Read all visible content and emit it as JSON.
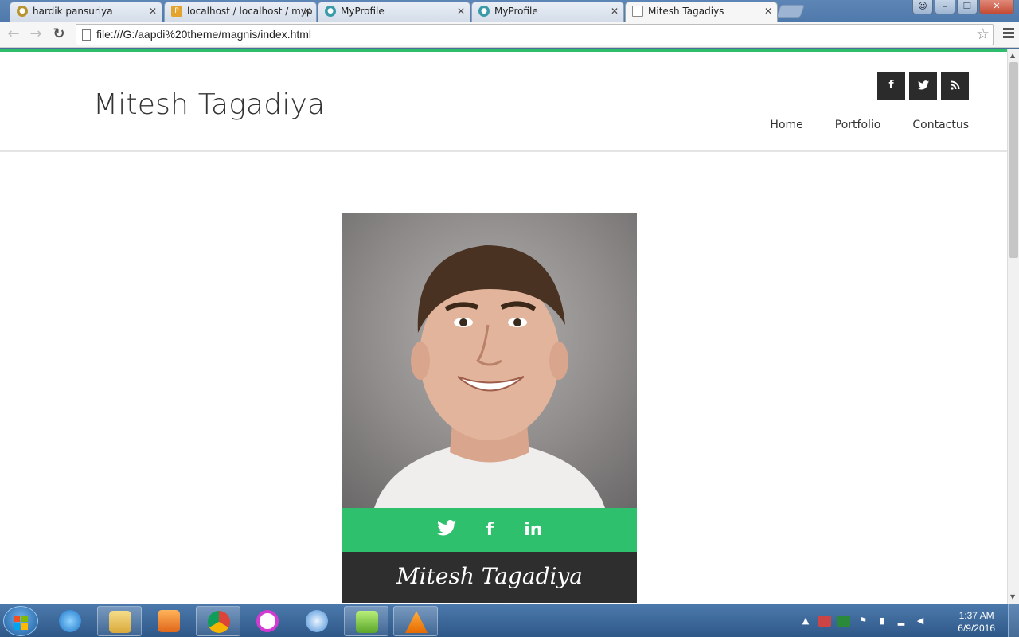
{
  "browser": {
    "tabs": [
      {
        "title": "hardik pansuriya",
        "favicon": "chrome-circle-icon",
        "active": false
      },
      {
        "title": "localhost / localhost / myp",
        "favicon": "phpmyadmin-icon",
        "active": false
      },
      {
        "title": "MyProfile",
        "favicon": "globe-icon",
        "active": false
      },
      {
        "title": "MyProfile",
        "favicon": "globe-icon",
        "active": false
      },
      {
        "title": "Mitesh Tagadiys",
        "favicon": "page-icon",
        "active": true
      }
    ],
    "url": "file:///G:/aapdi%20theme/magnis/index.html"
  },
  "site": {
    "brand": "Mitesh Tagadiya",
    "social_top": [
      {
        "icon": "facebook-icon",
        "glyph": "f"
      },
      {
        "icon": "twitter-icon",
        "glyph": "t"
      },
      {
        "icon": "rss-icon",
        "glyph": "◔"
      }
    ],
    "nav": [
      "Home",
      "Portfolio",
      "Contactus"
    ],
    "accent_color": "#2ebd6b",
    "card": {
      "social": [
        {
          "icon": "twitter-icon",
          "glyph": "t"
        },
        {
          "icon": "facebook-icon",
          "glyph": "f"
        },
        {
          "icon": "linkedin-icon",
          "glyph": "in"
        }
      ],
      "name": "Mitesh Tagadiya"
    }
  },
  "taskbar": {
    "time": "1:37 AM",
    "date": "6/9/2016"
  }
}
